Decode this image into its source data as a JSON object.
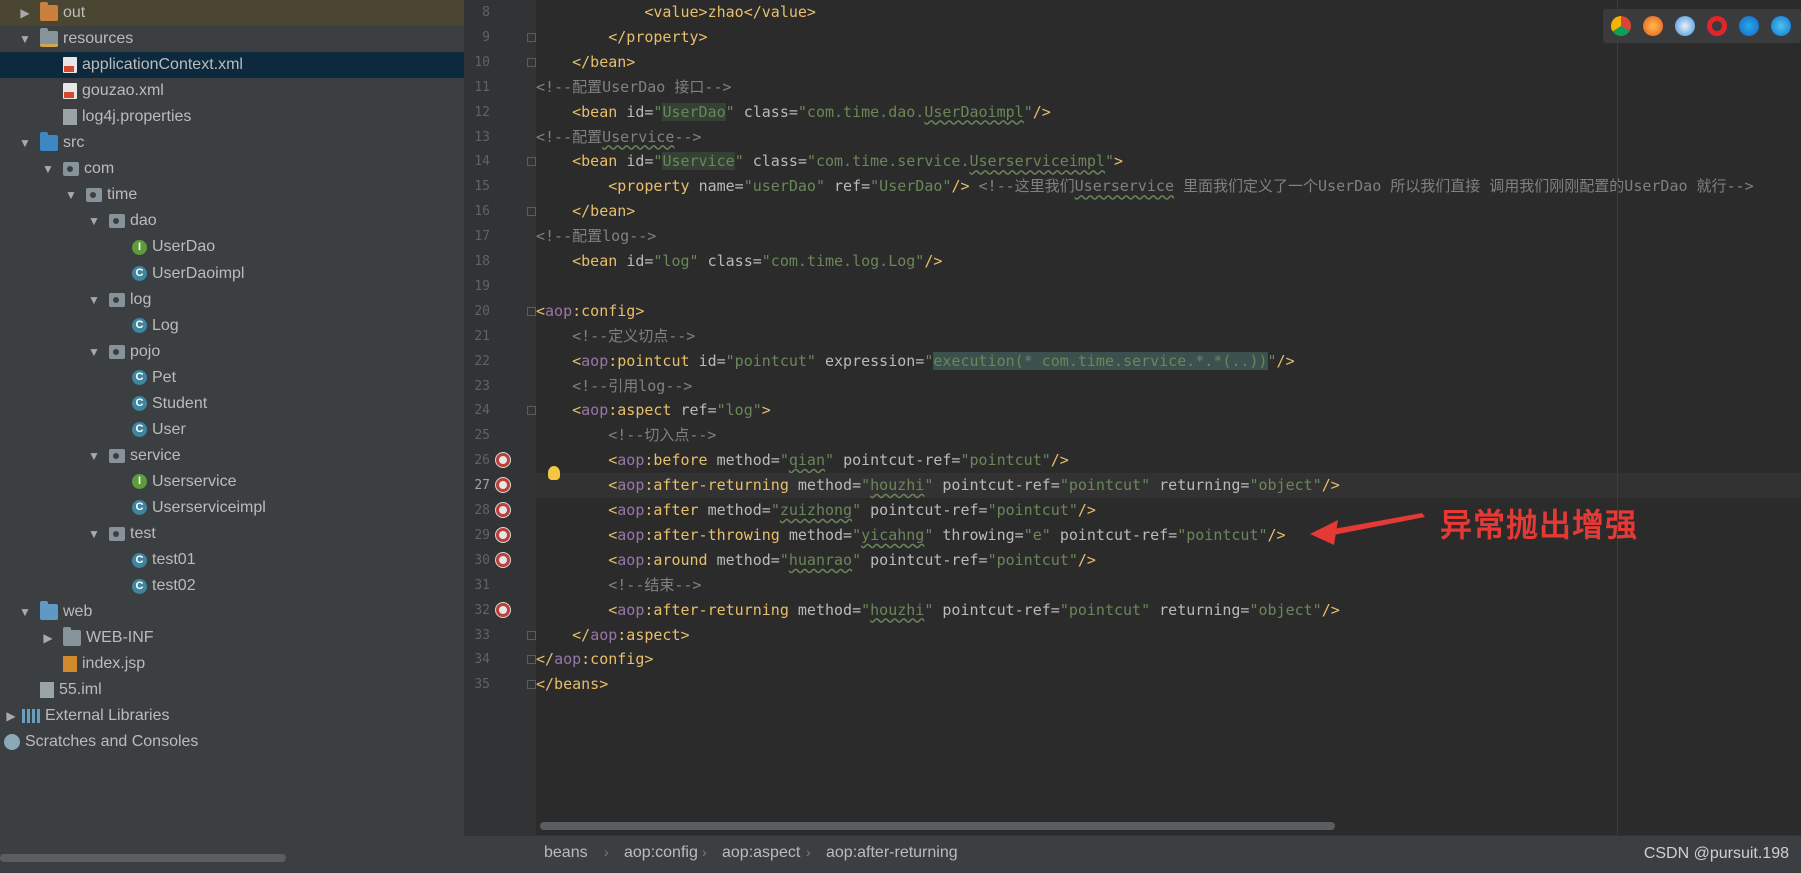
{
  "tree": [
    {
      "label": "out",
      "icon": "folder-out",
      "arrow": "right",
      "indent": 0,
      "state": "out"
    },
    {
      "label": "resources",
      "icon": "folder-resources",
      "arrow": "down",
      "indent": 0
    },
    {
      "label": "applicationContext.xml",
      "icon": "xml-file",
      "arrow": "",
      "indent": 1,
      "state": "selected"
    },
    {
      "label": "gouzao.xml",
      "icon": "xml-file",
      "arrow": "",
      "indent": 1
    },
    {
      "label": "log4j.properties",
      "icon": "properties-file",
      "arrow": "",
      "indent": 1
    },
    {
      "label": "src",
      "icon": "folder-src",
      "arrow": "down",
      "indent": 0
    },
    {
      "label": "com",
      "icon": "package",
      "arrow": "down",
      "indent": 1
    },
    {
      "label": "time",
      "icon": "package",
      "arrow": "down",
      "indent": 2
    },
    {
      "label": "dao",
      "icon": "package",
      "arrow": "down",
      "indent": 3
    },
    {
      "label": "UserDao",
      "icon": "interface",
      "arrow": "",
      "indent": 4
    },
    {
      "label": "UserDaoimpl",
      "icon": "class",
      "arrow": "",
      "indent": 4
    },
    {
      "label": "log",
      "icon": "package",
      "arrow": "down",
      "indent": 3
    },
    {
      "label": "Log",
      "icon": "class",
      "arrow": "",
      "indent": 4
    },
    {
      "label": "pojo",
      "icon": "package",
      "arrow": "down",
      "indent": 3
    },
    {
      "label": "Pet",
      "icon": "class",
      "arrow": "",
      "indent": 4
    },
    {
      "label": "Student",
      "icon": "class",
      "arrow": "",
      "indent": 4
    },
    {
      "label": "User",
      "icon": "class",
      "arrow": "",
      "indent": 4
    },
    {
      "label": "service",
      "icon": "package",
      "arrow": "down",
      "indent": 3
    },
    {
      "label": "Userservice",
      "icon": "interface",
      "arrow": "",
      "indent": 4
    },
    {
      "label": "Userserviceimpl",
      "icon": "class",
      "arrow": "",
      "indent": 4
    },
    {
      "label": "test",
      "icon": "package",
      "arrow": "down",
      "indent": 3
    },
    {
      "label": "test01",
      "icon": "class",
      "arrow": "",
      "indent": 4
    },
    {
      "label": "test02",
      "icon": "class",
      "arrow": "",
      "indent": 4
    },
    {
      "label": "web",
      "icon": "folder-web",
      "arrow": "down",
      "indent": 0
    },
    {
      "label": "WEB-INF",
      "icon": "folder",
      "arrow": "right",
      "indent": 1
    },
    {
      "label": "index.jsp",
      "icon": "jsp-file",
      "arrow": "",
      "indent": 1
    },
    {
      "label": "55.iml",
      "icon": "iml-file",
      "arrow": "",
      "indent": 0
    },
    {
      "label": "External Libraries",
      "icon": "libraries",
      "arrow": "right",
      "indent": -1
    },
    {
      "label": "Scratches and Consoles",
      "icon": "scratches",
      "arrow": "",
      "indent": -1
    }
  ],
  "editor": {
    "current_line": 27,
    "lines": [
      {
        "n": 8,
        "segs": [
          [
            "plain",
            "            "
          ],
          [
            "tag",
            "<value>"
          ],
          [
            "tag",
            "zhao"
          ],
          [
            "tag",
            "</value>"
          ]
        ]
      },
      {
        "n": 9,
        "segs": [
          [
            "plain",
            "        "
          ],
          [
            "tag",
            "</property>"
          ]
        ]
      },
      {
        "n": 10,
        "segs": [
          [
            "plain",
            "    "
          ],
          [
            "tag",
            "</bean>"
          ]
        ]
      },
      {
        "n": 11,
        "segs": [
          [
            "cmt",
            "<!--配置UserDao 接口-->"
          ]
        ]
      },
      {
        "n": 12,
        "segs": [
          [
            "plain",
            "    "
          ],
          [
            "tag",
            "<bean "
          ],
          [
            "attr",
            "id="
          ],
          [
            "val",
            "\""
          ],
          [
            "hl",
            "UserDao"
          ],
          [
            "val",
            "\" "
          ],
          [
            "attr",
            "class="
          ],
          [
            "val",
            "\"com.time.dao."
          ],
          [
            "valw",
            "UserDaoimpl"
          ],
          [
            "val",
            "\""
          ],
          [
            "tag",
            "/>"
          ]
        ]
      },
      {
        "n": 13,
        "segs": [
          [
            "cmt",
            "<!--配置"
          ],
          [
            "cmtw",
            "Uservice"
          ],
          [
            "cmt",
            "-->"
          ]
        ]
      },
      {
        "n": 14,
        "segs": [
          [
            "plain",
            "    "
          ],
          [
            "tag",
            "<bean "
          ],
          [
            "attr",
            "id="
          ],
          [
            "val",
            "\""
          ],
          [
            "hl",
            "Uservice"
          ],
          [
            "val",
            "\" "
          ],
          [
            "attr",
            "class="
          ],
          [
            "val",
            "\"com.time.service."
          ],
          [
            "valw",
            "Userserviceimpl"
          ],
          [
            "val",
            "\""
          ],
          [
            "tag",
            ">"
          ]
        ]
      },
      {
        "n": 15,
        "segs": [
          [
            "plain",
            "        "
          ],
          [
            "tag",
            "<property "
          ],
          [
            "attr",
            "name="
          ],
          [
            "val",
            "\"userDao\" "
          ],
          [
            "attr",
            "ref="
          ],
          [
            "val",
            "\"UserDao\""
          ],
          [
            "tag",
            "/> "
          ],
          [
            "cmt",
            "<!--这里我们"
          ],
          [
            "cmtw",
            "Userservice"
          ],
          [
            "cmt",
            " 里面我们定义了一个UserDao 所以我们直接 调用我们刚刚配置的UserDao 就行-->"
          ]
        ]
      },
      {
        "n": 16,
        "segs": [
          [
            "plain",
            "    "
          ],
          [
            "tag",
            "</bean>"
          ]
        ]
      },
      {
        "n": 17,
        "segs": [
          [
            "cmt",
            "<!--配置log-->"
          ]
        ]
      },
      {
        "n": 18,
        "segs": [
          [
            "plain",
            "    "
          ],
          [
            "tag",
            "<bean "
          ],
          [
            "attr",
            "id="
          ],
          [
            "val",
            "\"log\" "
          ],
          [
            "attr",
            "class="
          ],
          [
            "val",
            "\"com.time.log.Log\""
          ],
          [
            "tag",
            "/>"
          ]
        ]
      },
      {
        "n": 19,
        "segs": []
      },
      {
        "n": 20,
        "segs": [
          [
            "tag",
            "<"
          ],
          [
            "ns",
            "aop"
          ],
          [
            "tag",
            ":config>"
          ]
        ]
      },
      {
        "n": 21,
        "segs": [
          [
            "plain",
            "    "
          ],
          [
            "cmt",
            "<!--定义切点-->"
          ]
        ]
      },
      {
        "n": 22,
        "segs": [
          [
            "plain",
            "    "
          ],
          [
            "tag",
            "<"
          ],
          [
            "ns",
            "aop"
          ],
          [
            "tag",
            ":pointcut "
          ],
          [
            "attr",
            "id="
          ],
          [
            "val",
            "\"pointcut\" "
          ],
          [
            "attr",
            "expression="
          ],
          [
            "val",
            "\""
          ],
          [
            "hl2",
            "execution(* com.time.service.*.*(..))"
          ],
          [
            "val",
            "\""
          ],
          [
            "tag",
            "/>"
          ]
        ]
      },
      {
        "n": 23,
        "segs": [
          [
            "plain",
            "    "
          ],
          [
            "cmt",
            "<!--引用log-->"
          ]
        ]
      },
      {
        "n": 24,
        "segs": [
          [
            "plain",
            "    "
          ],
          [
            "tag",
            "<"
          ],
          [
            "ns",
            "aop"
          ],
          [
            "tag",
            ":aspect "
          ],
          [
            "attr",
            "ref="
          ],
          [
            "val",
            "\"log\""
          ],
          [
            "tag",
            ">"
          ]
        ]
      },
      {
        "n": 25,
        "segs": [
          [
            "plain",
            "        "
          ],
          [
            "cmt",
            "<!--切入点-->"
          ]
        ]
      },
      {
        "n": 26,
        "segs": [
          [
            "plain",
            "        "
          ],
          [
            "tag",
            "<"
          ],
          [
            "ns",
            "aop"
          ],
          [
            "tag",
            ":before "
          ],
          [
            "attr",
            "method="
          ],
          [
            "val",
            "\""
          ],
          [
            "valw",
            "qian"
          ],
          [
            "val",
            "\" "
          ],
          [
            "attr",
            "pointcut-ref="
          ],
          [
            "val",
            "\"pointcut\""
          ],
          [
            "tag",
            "/>"
          ]
        ]
      },
      {
        "n": 27,
        "segs": [
          [
            "plain",
            "        "
          ],
          [
            "tag",
            "<"
          ],
          [
            "ns",
            "aop"
          ],
          [
            "tag",
            ":after-returning "
          ],
          [
            "attr",
            "method="
          ],
          [
            "val",
            "\""
          ],
          [
            "valw",
            "houzhi"
          ],
          [
            "val",
            "\" "
          ],
          [
            "attr",
            "pointcut-ref="
          ],
          [
            "val",
            "\"pointcut\" "
          ],
          [
            "attr",
            "returning="
          ],
          [
            "val",
            "\"object\""
          ],
          [
            "tag",
            "/>"
          ]
        ]
      },
      {
        "n": 28,
        "segs": [
          [
            "plain",
            "        "
          ],
          [
            "tag",
            "<"
          ],
          [
            "ns",
            "aop"
          ],
          [
            "tag",
            ":after "
          ],
          [
            "attr",
            "method="
          ],
          [
            "val",
            "\""
          ],
          [
            "valw",
            "zuizhong"
          ],
          [
            "val",
            "\" "
          ],
          [
            "attr",
            "pointcut-ref="
          ],
          [
            "val",
            "\"pointcut\""
          ],
          [
            "tag",
            "/>"
          ]
        ]
      },
      {
        "n": 29,
        "segs": [
          [
            "plain",
            "        "
          ],
          [
            "tag",
            "<"
          ],
          [
            "ns",
            "aop"
          ],
          [
            "tag",
            ":after-throwing "
          ],
          [
            "attr",
            "method="
          ],
          [
            "val",
            "\""
          ],
          [
            "valw",
            "yicahng"
          ],
          [
            "val",
            "\" "
          ],
          [
            "attr",
            "throwing="
          ],
          [
            "val",
            "\"e\" "
          ],
          [
            "attr",
            "pointcut-ref="
          ],
          [
            "val",
            "\"pointcut\""
          ],
          [
            "tag",
            "/>"
          ]
        ]
      },
      {
        "n": 30,
        "segs": [
          [
            "plain",
            "        "
          ],
          [
            "tag",
            "<"
          ],
          [
            "ns",
            "aop"
          ],
          [
            "tag",
            ":around "
          ],
          [
            "attr",
            "method="
          ],
          [
            "val",
            "\""
          ],
          [
            "valw",
            "huanrao"
          ],
          [
            "val",
            "\" "
          ],
          [
            "attr",
            "pointcut-ref="
          ],
          [
            "val",
            "\"pointcut\""
          ],
          [
            "tag",
            "/>"
          ]
        ]
      },
      {
        "n": 31,
        "segs": [
          [
            "plain",
            "        "
          ],
          [
            "cmt",
            "<!--结束-->"
          ]
        ]
      },
      {
        "n": 32,
        "segs": [
          [
            "plain",
            "        "
          ],
          [
            "tag",
            "<"
          ],
          [
            "ns",
            "aop"
          ],
          [
            "tag",
            ":after-returning "
          ],
          [
            "attr",
            "method="
          ],
          [
            "val",
            "\""
          ],
          [
            "valw",
            "houzhi"
          ],
          [
            "val",
            "\" "
          ],
          [
            "attr",
            "pointcut-ref="
          ],
          [
            "val",
            "\"pointcut\" "
          ],
          [
            "attr",
            "returning="
          ],
          [
            "val",
            "\"object\""
          ],
          [
            "tag",
            "/>"
          ]
        ]
      },
      {
        "n": 33,
        "segs": [
          [
            "plain",
            "    "
          ],
          [
            "tag",
            "</"
          ],
          [
            "ns",
            "aop"
          ],
          [
            "tag",
            ":aspect>"
          ]
        ]
      },
      {
        "n": 34,
        "segs": [
          [
            "tag",
            "</"
          ],
          [
            "ns",
            "aop"
          ],
          [
            "tag",
            ":config>"
          ]
        ]
      },
      {
        "n": 35,
        "segs": [
          [
            "tag",
            "</beans>"
          ]
        ]
      }
    ]
  },
  "gutter_markers": [
    26,
    27,
    28,
    29,
    30,
    32
  ],
  "fold_markers": [
    9,
    10,
    14,
    16,
    20,
    24,
    33,
    34,
    35
  ],
  "annotation": {
    "text": "异常抛出增强",
    "color": "#e53935"
  },
  "browsers": [
    "chrome-icon",
    "firefox-icon",
    "safari-icon",
    "opera-icon",
    "ie-icon",
    "edge-icon"
  ],
  "breadcrumbs": [
    "beans",
    "aop:config",
    "aop:aspect",
    "aop:after-returning"
  ],
  "watermark": "CSDN @pursuit.198",
  "colors": {
    "tag": "#e8bf6a",
    "attr": "#bababa",
    "value": "#6a8759",
    "namespace": "#9876aa",
    "comment": "#808080",
    "selection": "#0d293e"
  }
}
